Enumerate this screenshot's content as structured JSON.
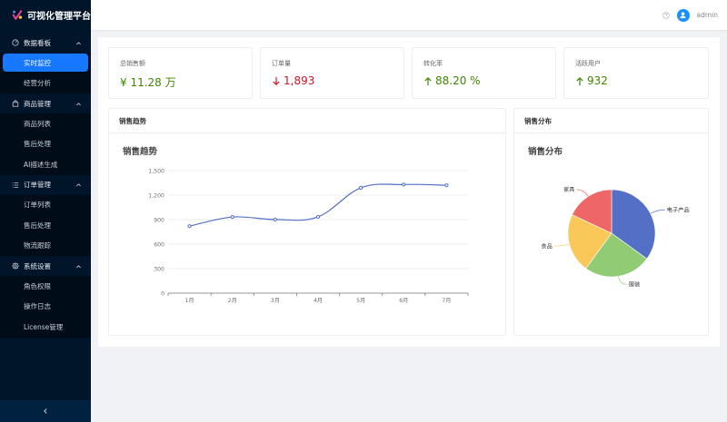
{
  "app": {
    "title": "可视化管理平台"
  },
  "sidebar": {
    "groups": [
      {
        "label": "数据看板",
        "icon": "dashboard-icon",
        "items": [
          {
            "label": "实时监控",
            "active": true
          },
          {
            "label": "经营分析",
            "active": false
          }
        ]
      },
      {
        "label": "商品管理",
        "icon": "shopping-bag-icon",
        "items": [
          {
            "label": "商品列表",
            "active": false
          },
          {
            "label": "售后处理",
            "active": false
          },
          {
            "label": "AI描述生成",
            "active": false
          }
        ]
      },
      {
        "label": "订单管理",
        "icon": "list-icon",
        "items": [
          {
            "label": "订单列表",
            "active": false
          },
          {
            "label": "售后处理",
            "active": false
          },
          {
            "label": "物流跟踪",
            "active": false
          }
        ]
      },
      {
        "label": "系统设置",
        "icon": "gear-icon",
        "items": [
          {
            "label": "角色权限",
            "active": false
          },
          {
            "label": "操作日志",
            "active": false
          },
          {
            "label": "License管理",
            "active": false
          }
        ]
      }
    ]
  },
  "header": {
    "username": "admin"
  },
  "stats": [
    {
      "label": "总销售额",
      "value": "¥ 11.28 万",
      "trend": "none",
      "color": "#3f8600"
    },
    {
      "label": "订单量",
      "value": "1,893",
      "trend": "down",
      "color": "#cf1322"
    },
    {
      "label": "转化率",
      "value": "88.20 %",
      "trend": "up",
      "color": "#3f8600"
    },
    {
      "label": "活跃用户",
      "value": "932",
      "trend": "up",
      "color": "#3f8600"
    }
  ],
  "cards": {
    "trend": {
      "header": "销售趋势"
    },
    "distribution": {
      "header": "销售分布"
    }
  },
  "chart_data": [
    {
      "type": "line",
      "title": "销售趋势",
      "categories": [
        "1月",
        "2月",
        "3月",
        "4月",
        "5月",
        "6月",
        "7月"
      ],
      "series": [
        {
          "values": [
            820,
            932,
            901,
            934,
            1290,
            1330,
            1320
          ]
        }
      ],
      "ylim": [
        0,
        1500
      ],
      "yticks": [
        0,
        300,
        600,
        900,
        "1,200",
        "1,500"
      ],
      "color": "#5470c6",
      "smooth": true,
      "grid": true
    },
    {
      "type": "pie",
      "title": "销售分布",
      "slices": [
        {
          "label": "电子产品",
          "value": 35,
          "color": "#5470c6"
        },
        {
          "label": "服装",
          "value": 25,
          "color": "#91cc75"
        },
        {
          "label": "食品",
          "value": 22,
          "color": "#fac858"
        },
        {
          "label": "家具",
          "value": 18,
          "color": "#ee6666"
        }
      ]
    }
  ],
  "colors": {
    "sidebar_bg": "#001529",
    "accent": "#1677ff"
  }
}
